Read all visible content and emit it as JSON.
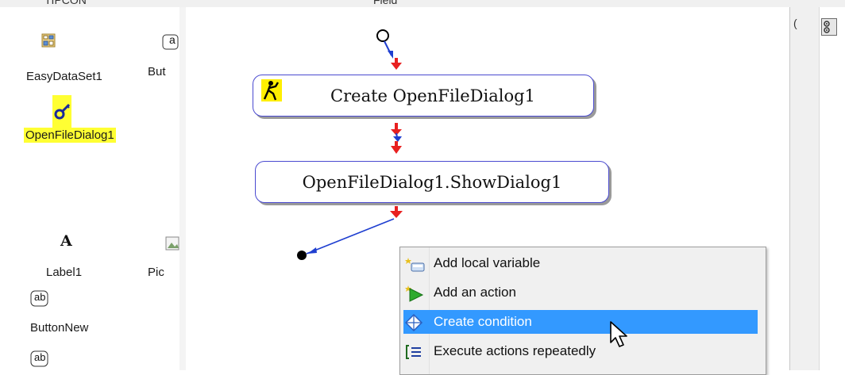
{
  "top_strip": {
    "left_text": "TIPCON",
    "mid_text": "Field"
  },
  "toolbox": {
    "components": [
      {
        "id": "easydataset",
        "label": "EasyDataSet1",
        "icon": "dataset-icon"
      },
      {
        "id": "button-partial",
        "label": "But",
        "icon": "button-icon",
        "icon_text": "a"
      },
      {
        "id": "openfiledialog",
        "label": "OpenFileDialog1",
        "icon": "file-dialog-icon",
        "selected": true
      },
      {
        "id": "label",
        "label": "Label1",
        "icon": "label-icon",
        "icon_text": "A"
      },
      {
        "id": "picture-partial",
        "label": "Pic",
        "icon": "picture-icon"
      },
      {
        "id": "buttonnew",
        "label": "ButtonNew",
        "icon": "button-icon",
        "icon_text": "ab"
      },
      {
        "id": "button-bottom",
        "label": "",
        "icon": "button-icon",
        "icon_text": "ab"
      }
    ]
  },
  "flow": {
    "nodes": [
      {
        "label": "Create OpenFileDialog1",
        "icon": "create-object-icon"
      },
      {
        "label": "OpenFileDialog1.ShowDialog1"
      }
    ]
  },
  "right_pane": {
    "partial_text": "("
  },
  "context_menu": {
    "items": [
      {
        "label": "Add local variable",
        "icon": "add-variable-icon"
      },
      {
        "label": "Add an action",
        "icon": "add-action-icon"
      },
      {
        "label": "Create condition",
        "icon": "condition-icon",
        "highlighted": true
      },
      {
        "label": "Execute actions repeatedly",
        "icon": "repeat-icon"
      }
    ]
  },
  "colors": {
    "selection_yellow": "#ffff33",
    "menu_highlight": "#3399ff",
    "node_border": "#4a4ad0",
    "arrow_red": "#e82020",
    "link_blue": "#1f3fd0"
  }
}
